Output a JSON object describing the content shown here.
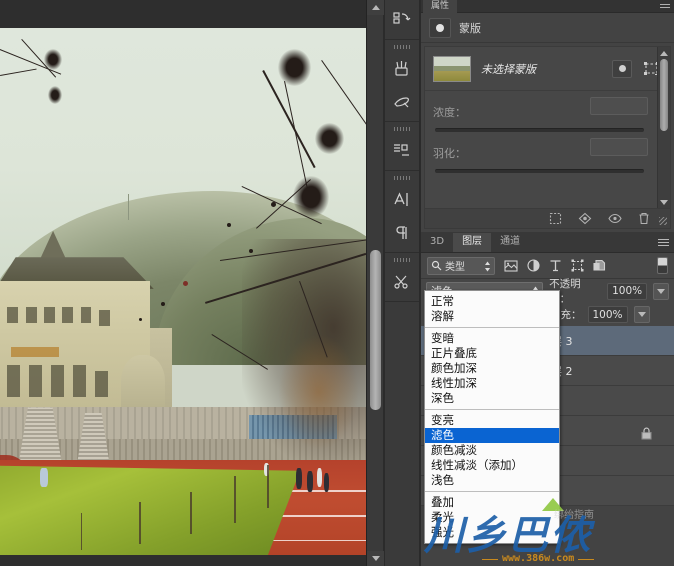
{
  "app": "Adobe Photoshop",
  "canvas": {
    "document_name": "photo-document",
    "scrollbar": "canvas-vertical-scrollbar"
  },
  "tools": [
    {
      "name": "3d-rotate-tool",
      "glyph": "3d"
    },
    {
      "name": "brush-tool",
      "glyph": "brush"
    },
    {
      "name": "eraser-tool",
      "glyph": "eraser"
    },
    {
      "name": "gradient-tool",
      "glyph": "gradient"
    },
    {
      "name": "type-tool",
      "glyph": "type"
    },
    {
      "name": "paragraph-tool",
      "glyph": "paragraph"
    },
    {
      "name": "edit-tools",
      "glyph": "scissors"
    }
  ],
  "properties_panel": {
    "tab_label": "属性",
    "header_title": "蒙版",
    "mask_item_label": "未选择蒙版",
    "sliders": [
      {
        "label": "浓度：",
        "value": ""
      },
      {
        "label": "羽化：",
        "value": ""
      }
    ],
    "footer_icons": [
      "selection-icon",
      "mask-apply-icon",
      "visibility-icon",
      "trash-icon"
    ]
  },
  "layers_panel": {
    "tabs": [
      {
        "label": "3D",
        "active": false
      },
      {
        "label": "图层",
        "active": true
      },
      {
        "label": "通道",
        "active": false
      }
    ],
    "filter": {
      "type_label": "类型",
      "icons": [
        "pixel-filter-icon",
        "adjustment-filter-icon",
        "type-filter-icon",
        "shape-filter-icon",
        "smart-object-filter-icon"
      ]
    },
    "blend_mode_value": "滤色",
    "opacity_label": "不透明度：",
    "opacity_value": "100%",
    "fill_label": "填充：",
    "fill_value": "100%",
    "layers": [
      {
        "name": "图层 3",
        "selected": true,
        "locked": false
      },
      {
        "name": "图层 2",
        "selected": false,
        "locked": false
      },
      {
        "name": "",
        "selected": false,
        "locked": false
      },
      {
        "name": "",
        "selected": false,
        "locked": true
      }
    ]
  },
  "blend_dropdown": {
    "open": true,
    "selected": "滤色",
    "groups": [
      [
        "正常",
        "溶解"
      ],
      [
        "变暗",
        "正片叠底",
        "颜色加深",
        "线性加深",
        "深色"
      ],
      [
        "变亮",
        "滤色",
        "颜色减淡",
        "线性减淡（添加）",
        "浅色"
      ],
      [
        "叠加",
        "柔光",
        "强光"
      ]
    ]
  },
  "watermark": {
    "badge": "绑绐指南",
    "main": "川乡巴侬",
    "url": "www.386w.com"
  },
  "colors": {
    "panel_bg": "#434343",
    "panel_light": "#4a4a4a",
    "selection_blue": "#0a64d2",
    "layer_selected": "#5d6a7a",
    "watermark_blue": "#1d5fa8"
  }
}
